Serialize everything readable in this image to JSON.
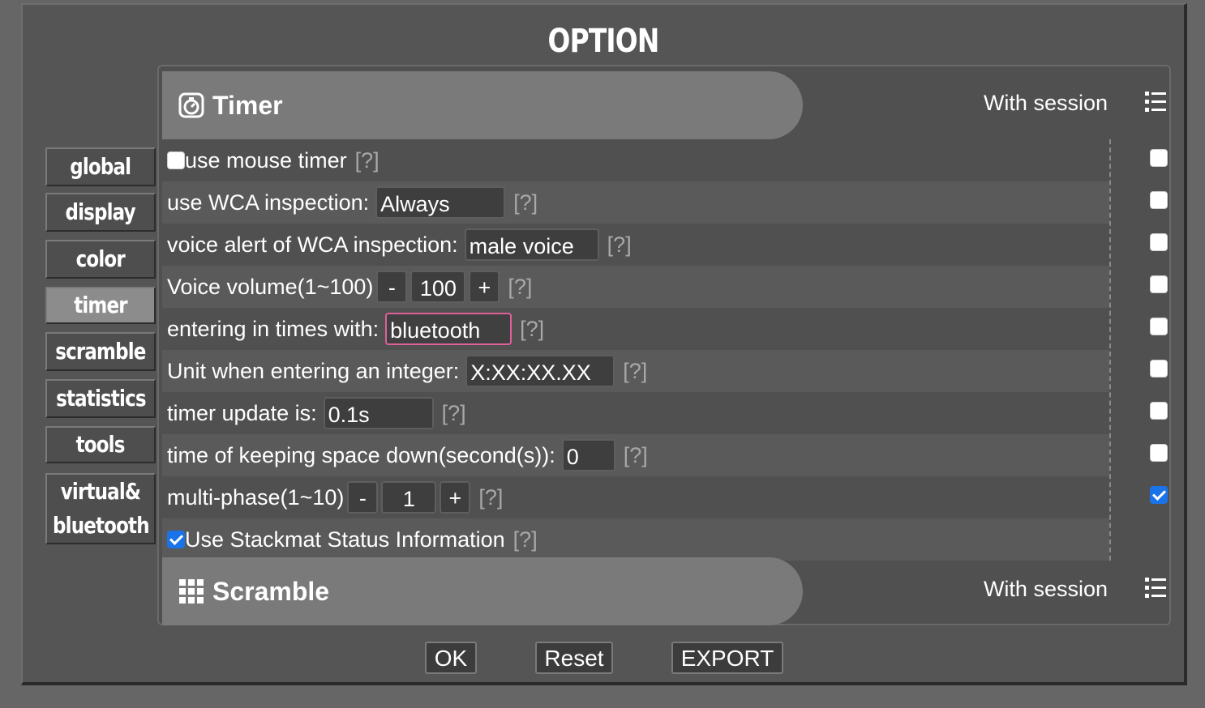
{
  "dialog": {
    "title": "OPTION"
  },
  "nav": [
    {
      "label": "global",
      "active": false
    },
    {
      "label": "display",
      "active": false
    },
    {
      "label": "color",
      "active": false
    },
    {
      "label": "timer",
      "active": true
    },
    {
      "label": "scramble",
      "active": false
    },
    {
      "label": "statistics",
      "active": false
    },
    {
      "label": "tools",
      "active": false
    },
    {
      "label": "virtual&",
      "label2": "bluetooth",
      "active": false
    }
  ],
  "timer_section": {
    "title": "Timer",
    "session_label": "With session",
    "icon": "stopwatch-icon"
  },
  "scramble_section": {
    "title": "Scramble",
    "session_label": "With session",
    "icon": "grid-icon"
  },
  "help": "[?]",
  "rows": {
    "mouse_timer": {
      "label": "use mouse timer",
      "checked": false,
      "session": false
    },
    "wca_inspection": {
      "label": "use WCA inspection:",
      "value": "Always",
      "session": false
    },
    "voice_alert": {
      "label": "voice alert of WCA inspection:",
      "value": "male voice",
      "session": false
    },
    "voice_volume": {
      "label": "Voice volume(1~100)",
      "minus": "-",
      "value": "100",
      "plus": "+",
      "session": false
    },
    "entering": {
      "label": "entering in times with:",
      "value": "bluetooth",
      "session": false
    },
    "unit": {
      "label": "Unit when entering an integer:",
      "value": "X:XX:XX.XX",
      "session": false
    },
    "update": {
      "label": "timer update is:",
      "value": "0.1s",
      "session": false
    },
    "space": {
      "label": "time of keeping space down(second(s)):",
      "value": "0",
      "session": false
    },
    "multiphase": {
      "label": "multi-phase(1~10)",
      "minus": "-",
      "value": "1",
      "plus": "+",
      "session": true
    },
    "stackmat": {
      "label": "Use Stackmat Status Information",
      "checked": true
    }
  },
  "footer": {
    "ok": "OK",
    "reset": "Reset",
    "export": "EXPORT"
  }
}
